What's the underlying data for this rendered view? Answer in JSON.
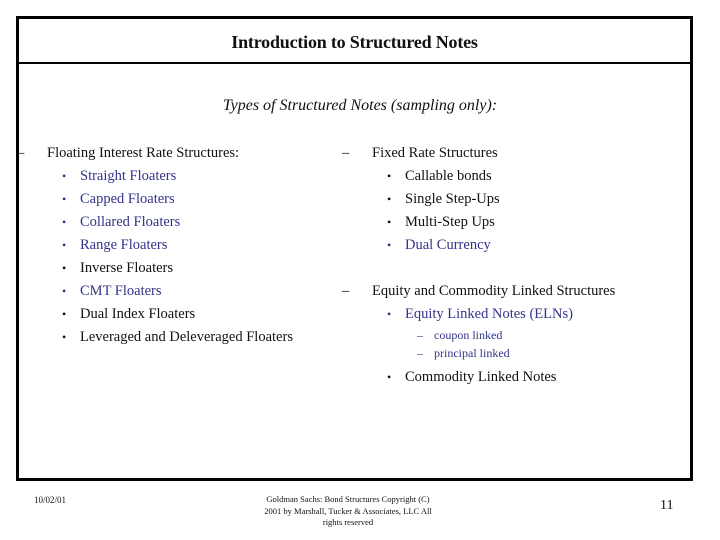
{
  "slide": {
    "title": "Introduction to Structured Notes",
    "subtitle": "Types of Structured Notes (sampling only):",
    "left_column": {
      "heading": "Floating Interest Rate Structures:",
      "items": [
        {
          "label": "Straight Floaters",
          "highlight": true
        },
        {
          "label": "Capped Floaters",
          "highlight": true
        },
        {
          "label": "Collared Floaters",
          "highlight": true
        },
        {
          "label": "Range Floaters",
          "highlight": true
        },
        {
          "label": "Inverse Floaters",
          "highlight": false
        },
        {
          "label": "CMT Floaters",
          "highlight": true
        },
        {
          "label": "Dual Index Floaters",
          "highlight": false
        },
        {
          "label": "Leveraged and Deleveraged Floaters",
          "highlight": false
        }
      ]
    },
    "right_column": {
      "sections": [
        {
          "heading": "Fixed Rate Structures",
          "items": [
            {
              "label": "Callable bonds",
              "highlight": false
            },
            {
              "label": "Single Step-Ups",
              "highlight": false
            },
            {
              "label": "Multi-Step Ups",
              "highlight": false
            },
            {
              "label": "Dual Currency",
              "highlight": true
            }
          ]
        },
        {
          "heading": "Equity and Commodity Linked Structures",
          "items": [
            {
              "label": "Equity Linked Notes (ELNs)",
              "highlight": true,
              "subitems": [
                "coupon linked",
                "principal linked"
              ]
            },
            {
              "label": "Commodity Linked Notes",
              "highlight": false
            }
          ]
        }
      ]
    },
    "symbols": {
      "dash": "–",
      "bullet": "•"
    },
    "colors": {
      "highlight": "#33338a",
      "text": "#111111",
      "border": "#000000"
    }
  },
  "footer": {
    "date": "10/02/01",
    "copyright_line1": "Goldman Sachs: Bond Structures   Copyright (C)",
    "copyright_line2": "2001 by Marshall, Tucker & Associates, LLC   All",
    "copyright_line3": "rights reserved",
    "page_number": "11"
  }
}
